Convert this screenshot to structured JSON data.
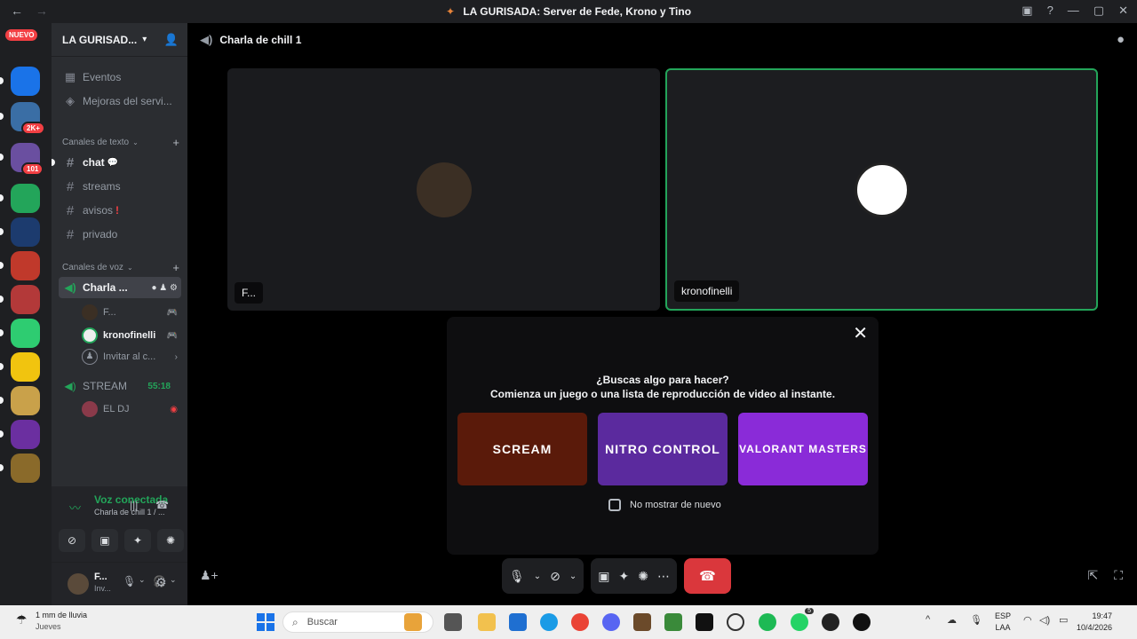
{
  "window": {
    "title": "LA GURISADA: Server de Fede, Krono y Tino",
    "nuevo_badge": "NUEVO"
  },
  "rail": {
    "servers": [
      {
        "name": "docs",
        "color": "#1a73e8",
        "badge": ""
      },
      {
        "name": "server-2",
        "color": "#3a6ea5",
        "badge": "2K+"
      },
      {
        "name": "server-3",
        "color": "#6a4fa0",
        "badge": "101"
      },
      {
        "name": "folder",
        "color": "#23a55a",
        "badge": ""
      },
      {
        "name": "server-5",
        "color": "#1c3b6e",
        "badge": ""
      },
      {
        "name": "server-6",
        "color": "#c0392b",
        "badge": ""
      },
      {
        "name": "server-7",
        "color": "#b33939",
        "badge": ""
      },
      {
        "name": "server-8",
        "color": "#2ecc71",
        "badge": ""
      },
      {
        "name": "server-9",
        "color": "#f1c40f",
        "badge": ""
      },
      {
        "name": "server-10",
        "color": "#c9a14a",
        "badge": ""
      },
      {
        "name": "server-11",
        "color": "#6b2fa0",
        "badge": ""
      },
      {
        "name": "server-12",
        "color": "#8a6a2a",
        "badge": ""
      }
    ]
  },
  "sidebar": {
    "server_name": "LA GURISAD...",
    "events_label": "Eventos",
    "boosts_label": "Mejoras del servi...",
    "text_category": "Canales de texto",
    "text_channels": [
      {
        "name": "chat",
        "suffix": "💬"
      },
      {
        "name": "streams",
        "suffix": ""
      },
      {
        "name": "avisos",
        "suffix": "❗"
      },
      {
        "name": "privado",
        "suffix": ""
      }
    ],
    "voice_category": "Canales de voz",
    "voice_channel": "Charla ...",
    "voice_users": [
      {
        "name": "F...",
        "tag": "🎮"
      },
      {
        "name": "kronofinelli",
        "tag": "🎮"
      }
    ],
    "invite_label": "Invitar al c...",
    "stream_channel": "STREAM",
    "stream_timer": "55:18",
    "stream_user": "EL DJ"
  },
  "voice_status": {
    "title": "Voz conectada",
    "subtitle": "Charla de chill 1 / ..."
  },
  "user_panel": {
    "name": "F...",
    "status": "Inv..."
  },
  "call": {
    "channel_title": "Charla de chill 1",
    "tiles": [
      {
        "label": "F...",
        "avatar_color": "#3b2f24",
        "speaking": false
      },
      {
        "label": "kronofinelli",
        "avatar_color": "#ffffff",
        "speaking": true
      }
    ]
  },
  "activity_panel": {
    "question": "¿Buscas algo para hacer?",
    "subtitle": "Comienza un juego o una lista de reproducción de video al instante.",
    "cards": [
      {
        "title": "SCREAM",
        "color": "#5a1a0a"
      },
      {
        "title": "NITRO CONTROL",
        "color": "#5b2a9e"
      },
      {
        "title": "VALORANT MASTERS",
        "color": "#8a2bd8"
      }
    ],
    "checkbox_label": "No mostrar de nuevo"
  },
  "taskbar": {
    "weather_line1": "1 mm de lluvia",
    "weather_line2": "Jueves",
    "search_placeholder": "Buscar",
    "lang_line1": "ESP",
    "lang_line2": "LAA",
    "time": "19:47",
    "date": "10/4/2026",
    "whatsapp_badge": "5"
  }
}
